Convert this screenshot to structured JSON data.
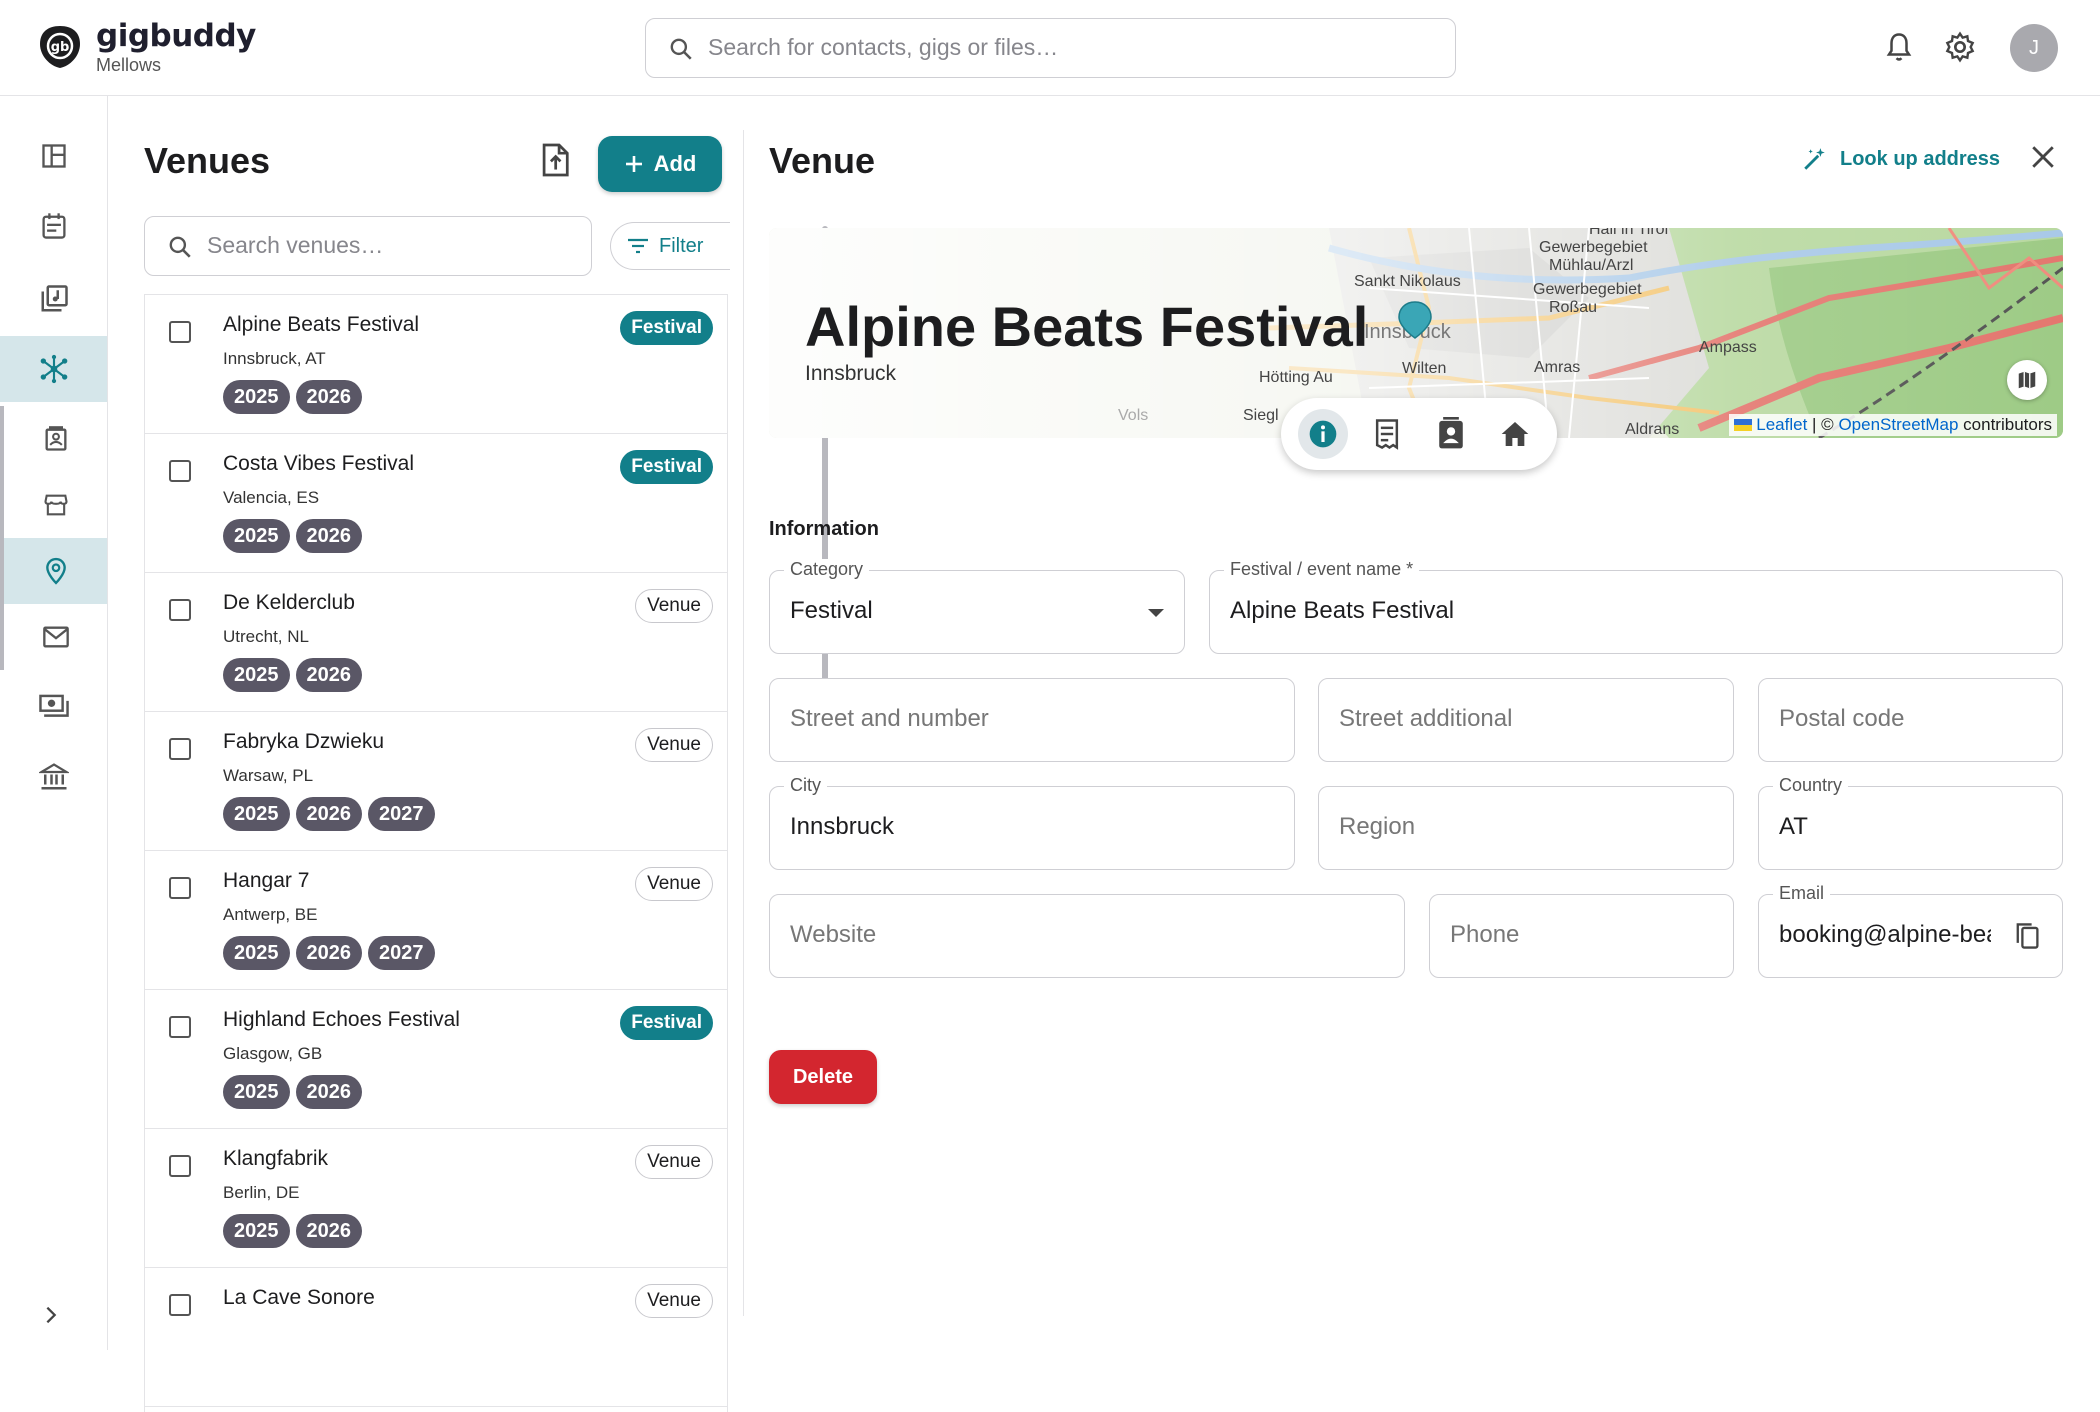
{
  "app": {
    "brand": "gigbuddy",
    "workspace": "Mellows",
    "avatar_initial": "J"
  },
  "search": {
    "placeholder": "Search for contacts, gigs or files…"
  },
  "venues_pane": {
    "title": "Venues",
    "add_label": "Add",
    "filter_label": "Filter",
    "search_placeholder": "Search venues…",
    "items": [
      {
        "name": "Alpine Beats Festival",
        "location": "Innsbruck, AT",
        "type": "Festival",
        "years": [
          "2025",
          "2026"
        ]
      },
      {
        "name": "Costa Vibes Festival",
        "location": "Valencia, ES",
        "type": "Festival",
        "years": [
          "2025",
          "2026"
        ]
      },
      {
        "name": "De Kelderclub",
        "location": "Utrecht, NL",
        "type": "Venue",
        "years": [
          "2025",
          "2026"
        ]
      },
      {
        "name": "Fabryka Dzwieku",
        "location": "Warsaw, PL",
        "type": "Venue",
        "years": [
          "2025",
          "2026",
          "2027"
        ]
      },
      {
        "name": "Hangar 7",
        "location": "Antwerp, BE",
        "type": "Venue",
        "years": [
          "2025",
          "2026",
          "2027"
        ]
      },
      {
        "name": "Highland Echoes Festival",
        "location": "Glasgow, GB",
        "type": "Festival",
        "years": [
          "2025",
          "2026"
        ]
      },
      {
        "name": "Klangfabrik",
        "location": "Berlin, DE",
        "type": "Venue",
        "years": [
          "2025",
          "2026"
        ]
      },
      {
        "name": "La Cave Sonore",
        "location": "",
        "type": "Venue",
        "years": []
      }
    ]
  },
  "detail": {
    "title": "Venue",
    "lookup_label": "Look up address",
    "map": {
      "title": "Alpine Beats Festival",
      "subtitle": "Innsbruck",
      "attribution_leaflet": "Leaflet",
      "attribution_sep": " | © ",
      "attribution_osm": "OpenStreetMap",
      "attribution_tail": " contributors",
      "place_labels": [
        "Hall in Tirol",
        "Gewerbegebiet",
        "Mühlau/Arzl",
        "Sankt Nikolaus",
        "Gewerbegebiet",
        "Roßau",
        "Innsbruck",
        "Ampass",
        "Amras",
        "Wilten",
        "Hötting Au",
        "Siegl",
        "Aldrans",
        "Vols"
      ]
    },
    "section_label": "Information",
    "fields": {
      "category": {
        "label": "Category",
        "value": "Festival"
      },
      "event_name": {
        "label": "Festival / event name *",
        "value": "Alpine Beats Festival"
      },
      "street": {
        "placeholder": "Street and number"
      },
      "street_additional": {
        "placeholder": "Street additional"
      },
      "postal_code": {
        "placeholder": "Postal code"
      },
      "city": {
        "label": "City",
        "value": "Innsbruck"
      },
      "region": {
        "placeholder": "Region"
      },
      "country": {
        "label": "Country",
        "value": "AT"
      },
      "website": {
        "placeholder": "Website"
      },
      "phone": {
        "placeholder": "Phone"
      },
      "email": {
        "label": "Email",
        "value": "booking@alpine-bea"
      }
    },
    "delete_label": "Delete"
  },
  "colors": {
    "accent": "#127f8a",
    "danger": "#d3262f",
    "chip": "#5a5766"
  }
}
